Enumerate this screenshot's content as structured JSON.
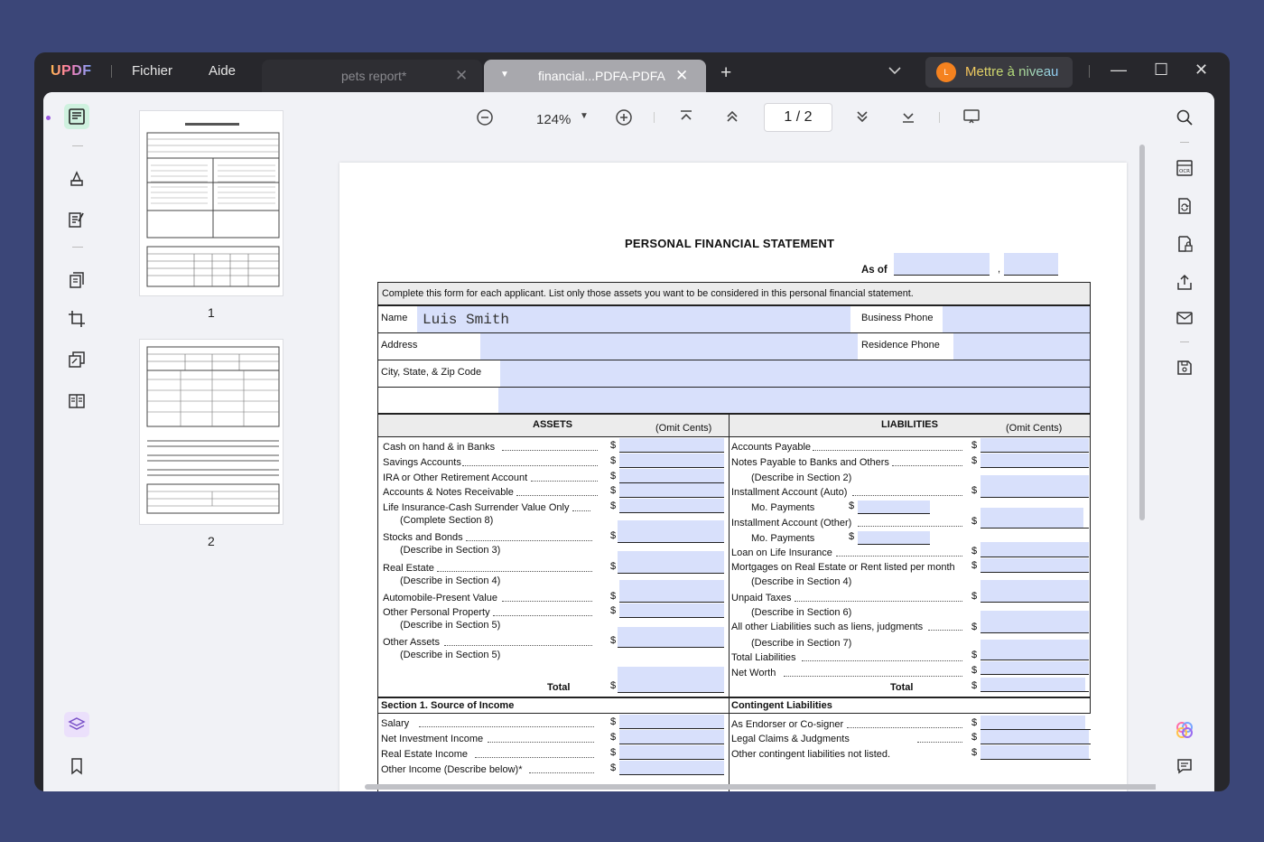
{
  "app": {
    "logo": "UPDF",
    "menu_file": "Fichier",
    "menu_help": "Aide"
  },
  "tabs": [
    {
      "label": "pets report*",
      "close": "✕"
    },
    {
      "label": "financial...PDFA-PDFA",
      "close": "✕"
    }
  ],
  "upgrade": {
    "avatar": "L",
    "label": "Mettre à niveau"
  },
  "window_controls": {
    "minimize": "—",
    "maximize": "☐",
    "close": "✕"
  },
  "toolbar": {
    "zoom": "124%",
    "page_indicator": "1 / 2"
  },
  "thumbnails": [
    {
      "number": "1"
    },
    {
      "number": "2"
    }
  ],
  "pdf": {
    "title": "PERSONAL FINANCIAL STATEMENT",
    "as_of": "As of",
    "instruction": "Complete this form for each applicant.  List only those assets you want to be considered in this personal financial statement.",
    "name_label": "Name",
    "name_value": "Luis Smith",
    "business_phone": "Business Phone",
    "address": "Address",
    "residence_phone": "Residence Phone",
    "city": "City, State, & Zip Code",
    "assets_header": "ASSETS",
    "liabilities_header": "LIABILITIES",
    "omit_cents": "(Omit Cents)",
    "assets": [
      "Cash on hand & in Banks",
      "Savings Accounts",
      "IRA or Other Retirement Account",
      "Accounts & Notes Receivable",
      "Life Insurance-Cash Surrender Value Only",
      "(Complete Section 8)",
      "Stocks and Bonds",
      "(Describe in Section 3)",
      "Real Estate",
      "(Describe in Section 4)",
      "Automobile-Present Value",
      "Other Personal Property",
      "(Describe in Section 5)",
      "Other Assets",
      "(Describe in Section 5)"
    ],
    "liabilities": [
      "Accounts Payable",
      "Notes Payable to Banks and Others",
      "(Describe in Section 2)",
      "Installment Account (Auto)",
      "Mo. Payments",
      "Installment Account (Other)",
      "Mo. Payments",
      "Loan on Life Insurance",
      "Mortgages on Real Estate or Rent listed per month",
      "(Describe in Section 4)",
      "Unpaid Taxes",
      "(Describe in Section 6)",
      "All other Liabilities such as liens, judgments",
      "(Describe in Section 7)",
      "Total Liabilities",
      "Net Worth"
    ],
    "total": "Total",
    "dollar": "$",
    "section1": "Section 1.      Source of Income",
    "contingent": "Contingent Liabilities",
    "income": [
      "Salary",
      "Net Investment Income",
      "Real Estate Income",
      "Other Income (Describe below)*"
    ],
    "contingent_items": [
      "As Endorser or Co-signer",
      "Legal Claims & Judgments",
      "Other contingent liabilities not listed."
    ]
  }
}
